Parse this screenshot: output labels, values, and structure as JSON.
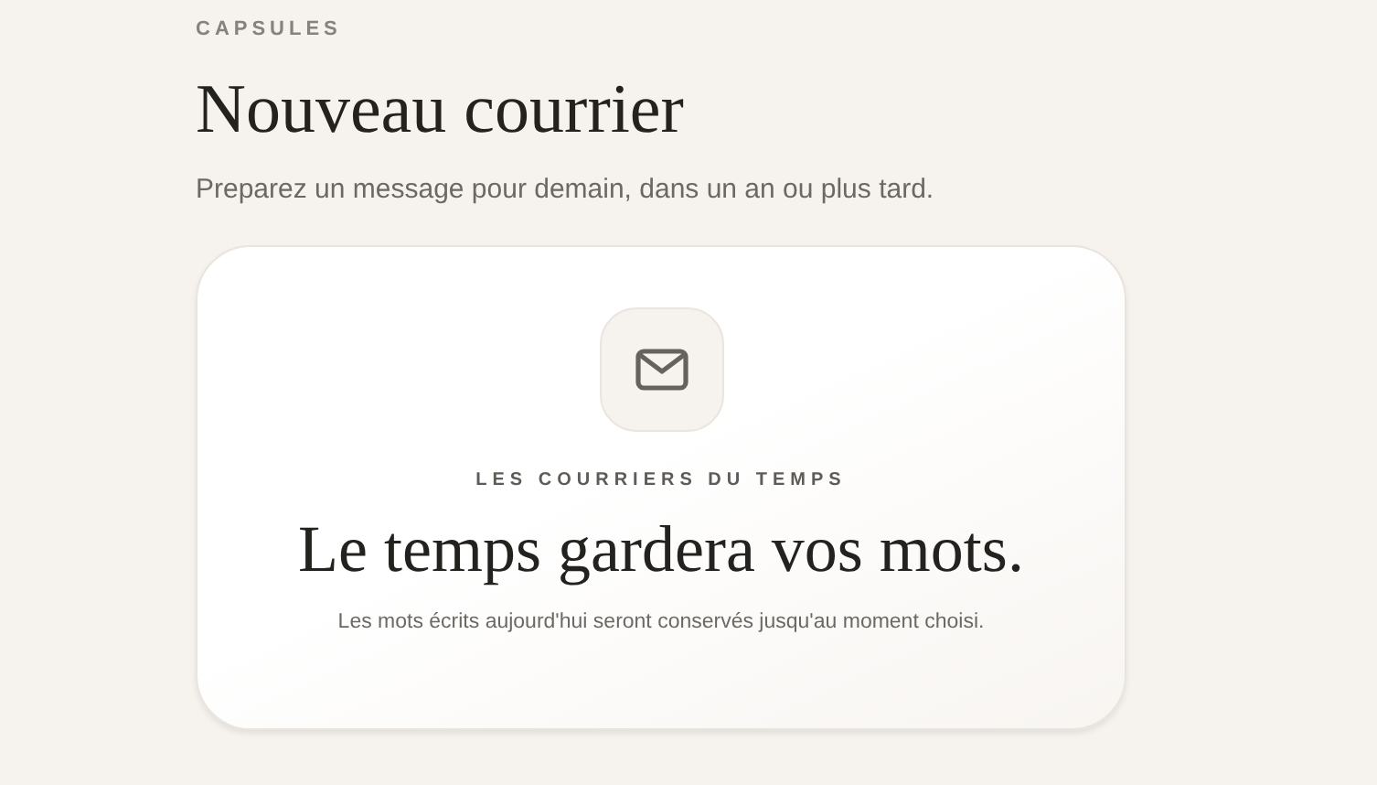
{
  "header": {
    "eyebrow": "CAPSULES",
    "title": "Nouveau courrier",
    "subtitle": "Preparez un message pour demain, dans un an ou plus tard."
  },
  "card": {
    "eyebrow": "LES COURRIERS DU TEMPS",
    "heading": "Le temps gardera vos mots.",
    "text": "Les mots écrits aujourd'hui seront conservés jusqu'au moment choisi."
  }
}
